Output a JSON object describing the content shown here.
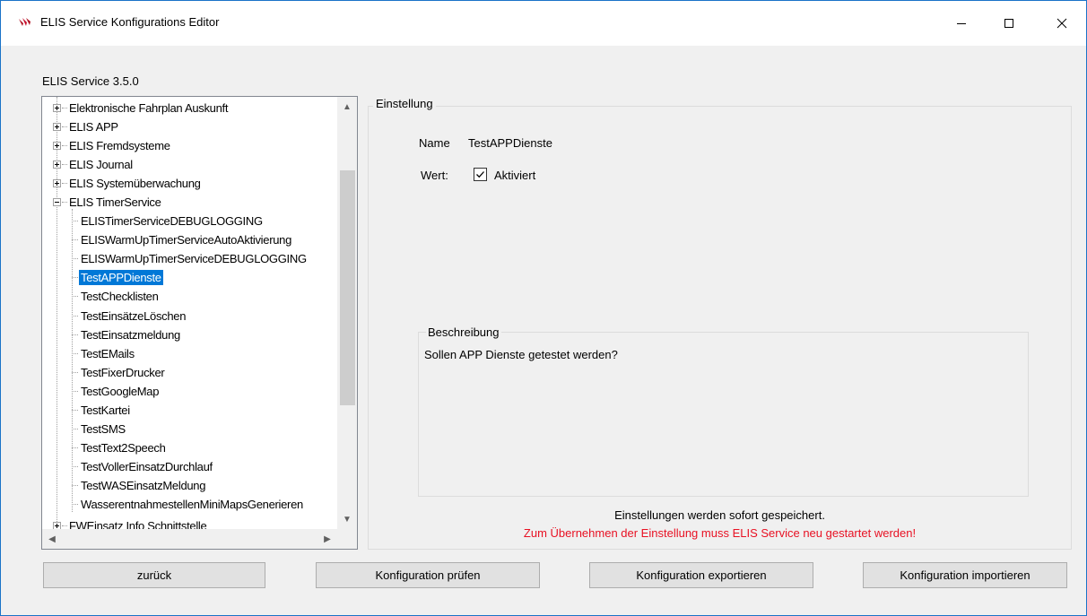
{
  "window": {
    "title": "ELIS Service Konfigurations Editor"
  },
  "version_label": "ELIS Service 3.5.0",
  "tree": {
    "top_nodes": [
      "Elektronische Fahrplan Auskunft",
      "ELIS APP",
      "ELIS Fremdsysteme",
      "ELIS Journal",
      "ELIS Systemüberwachung",
      "ELIS TimerService"
    ],
    "children": [
      "ELISTimerServiceDEBUGLOGGING",
      "ELISWarmUpTimerServiceAutoAktivierung",
      "ELISWarmUpTimerServiceDEBUGLOGGING",
      "TestAPPDienste",
      "TestChecklisten",
      "TestEinsätzeLöschen",
      "TestEinsatzmeldung",
      "TestEMails",
      "TestFixerDrucker",
      "TestGoogleMap",
      "TestKartei",
      "TestSMS",
      "TestText2Speech",
      "TestVollerEinsatzDurchlauf",
      "TestWASEinsatzMeldung",
      "WasserentnahmestellenMiniMapsGenerieren"
    ],
    "last_node": "FWEinsatz Info Schnittstelle",
    "selected": "TestAPPDienste"
  },
  "settings": {
    "group_title": "Einstellung",
    "name_label": "Name",
    "name_value": "TestAPPDienste",
    "value_label": "Wert:",
    "checkbox_label": "Aktiviert",
    "checkbox_checked": true,
    "description_title": "Beschreibung",
    "description_text": "Sollen APP Dienste getestet werden?"
  },
  "info": {
    "saved": "Einstellungen werden sofort gespeichert.",
    "restart": "Zum Übernehmen der Einstellung muss ELIS Service neu gestartet werden!",
    "restart_color": "#e81123"
  },
  "buttons": {
    "back": "zurück",
    "check": "Konfiguration prüfen",
    "export": "Konfiguration exportieren",
    "import": "Konfiguration importieren"
  }
}
